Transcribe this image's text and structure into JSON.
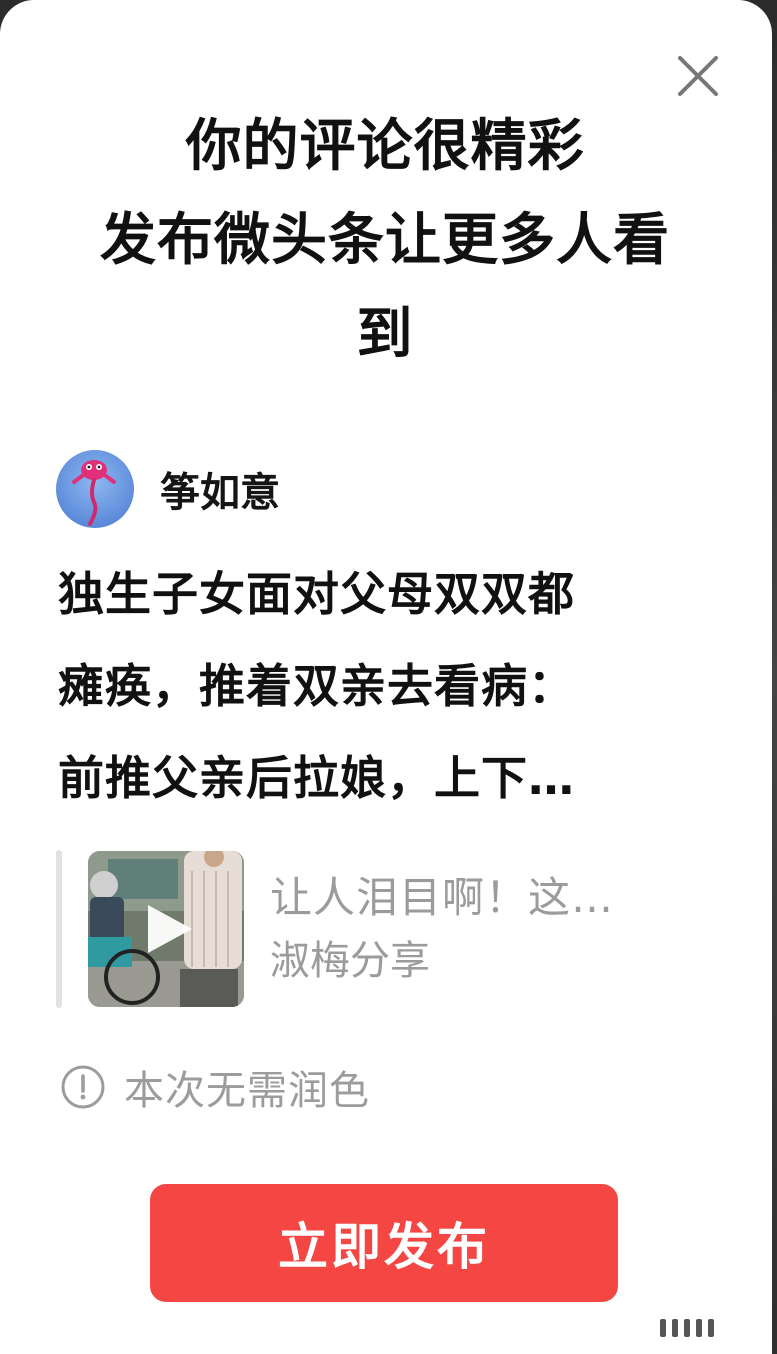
{
  "dialog": {
    "headline": [
      "你的评论很精彩",
      "发布微头条让更多人看",
      "到"
    ]
  },
  "author": {
    "name": "筝如意",
    "avatar_icon": "kite-avatar-icon"
  },
  "post": {
    "lines": [
      "独生子女面对父母双双都",
      "瘫痪，推着双亲去看病：",
      "前推父亲后拉娘，上下…"
    ]
  },
  "quoted": {
    "title": "让人泪目啊！这…",
    "source": "淑梅分享",
    "thumbnail_icon": "video-play-icon"
  },
  "notice": {
    "text": "本次无需润色",
    "icon": "info-circle-icon"
  },
  "actions": {
    "publish_label": "立即发布",
    "close_icon": "close-icon"
  },
  "colors": {
    "publish_button": "#f44744",
    "muted_text": "#9b9b9b",
    "primary_text": "#111111"
  }
}
